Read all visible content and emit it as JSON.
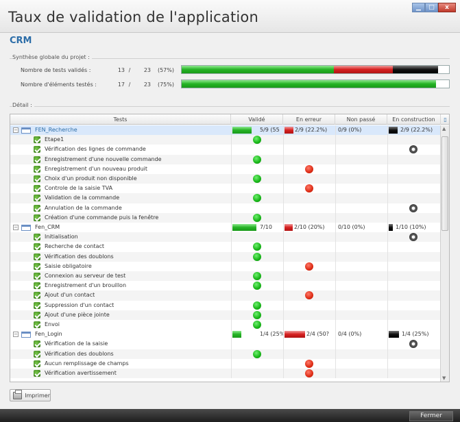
{
  "window": {
    "title": "Taux de validation de l'application",
    "subtitle": "CRM",
    "buttons": {
      "minimize": "▁",
      "maximize": "□",
      "close": "x"
    }
  },
  "synthese": {
    "label": "Synthèse globale du projet :",
    "rows": [
      {
        "label": "Nombre de tests validés :",
        "n": "13",
        "sep": "/",
        "total": "23",
        "pct": "(57%)",
        "fractions": {
          "valid": 0.57,
          "error": 0.22,
          "construction": 0.17
        }
      },
      {
        "label": "Nombre d'éléments testés :",
        "n": "17",
        "sep": "/",
        "total": "23",
        "pct": "(75%)",
        "fractions": {
          "valid": 0.95,
          "error": 0,
          "construction": 0
        }
      }
    ]
  },
  "detail": {
    "label": "Détail :",
    "headers": {
      "tests": "Tests",
      "valide": "Validé",
      "erreur": "En erreur",
      "non_passe": "Non passé",
      "construction": "En construction"
    },
    "rows": [
      {
        "type": "group",
        "name": "FEN_Recherche",
        "valide": "5/9 (55",
        "erreur": "2/9 (22.2%)",
        "non_passe": "0/9 (0%)",
        "construction": "2/9 (22.2%)",
        "v": 0.55,
        "e": 0.222,
        "c": 0.222,
        "selected": true
      },
      {
        "type": "test",
        "name": "Etape1",
        "status": "green"
      },
      {
        "type": "test",
        "name": "Vérification des lignes de commande",
        "status": "gear"
      },
      {
        "type": "test",
        "name": "Enregistrement d'une nouvelle commande",
        "status": "green"
      },
      {
        "type": "test",
        "name": "Enregistrement d'un nouveau produit",
        "status": "red"
      },
      {
        "type": "test",
        "name": "Choix d'un produit non disponible",
        "status": "green"
      },
      {
        "type": "test",
        "name": "Controle de la saisie TVA",
        "status": "red"
      },
      {
        "type": "test",
        "name": "Validation de la commande",
        "status": "green"
      },
      {
        "type": "test",
        "name": "Annulation de la commande",
        "status": "gear"
      },
      {
        "type": "test",
        "name": "Création d'une commande puis la fenêtre",
        "status": "green"
      },
      {
        "type": "group",
        "name": "Fen_CRM",
        "valide": "7/10",
        "erreur": "2/10 (20%)",
        "non_passe": "0/10 (0%)",
        "construction": "1/10 (10%)",
        "v": 0.7,
        "e": 0.2,
        "c": 0.1
      },
      {
        "type": "test",
        "name": "Initialisation",
        "status": "gear"
      },
      {
        "type": "test",
        "name": "Recherche de contact",
        "status": "green"
      },
      {
        "type": "test",
        "name": "Vérification des doublons",
        "status": "green"
      },
      {
        "type": "test",
        "name": "Saisie obligatoire",
        "status": "red"
      },
      {
        "type": "test",
        "name": "Connexion au serveur de test",
        "status": "green"
      },
      {
        "type": "test",
        "name": "Enregistrement d'un brouillon",
        "status": "green"
      },
      {
        "type": "test",
        "name": "Ajout d'un contact",
        "status": "red"
      },
      {
        "type": "test",
        "name": "Suppression d'un contact",
        "status": "green"
      },
      {
        "type": "test",
        "name": "Ajout d'une pièce jointe",
        "status": "green"
      },
      {
        "type": "test",
        "name": "Envoi",
        "status": "green"
      },
      {
        "type": "group",
        "name": "Fen_Login",
        "valide": "1/4 (25%)",
        "erreur": "2/4 (50?",
        "non_passe": "0/4 (0%)",
        "construction": "1/4 (25%)",
        "v": 0.25,
        "e": 0.5,
        "c": 0.25
      },
      {
        "type": "test",
        "name": "Vérification de la saisie",
        "status": "gear"
      },
      {
        "type": "test",
        "name": "Vérification des doublons",
        "status": "green"
      },
      {
        "type": "test",
        "name": "Aucun remplissage de champs",
        "status": "red"
      },
      {
        "type": "test",
        "name": "Vérification avertissement",
        "status": "red"
      }
    ]
  },
  "buttons": {
    "print": "Imprimer",
    "close": "Fermer"
  }
}
